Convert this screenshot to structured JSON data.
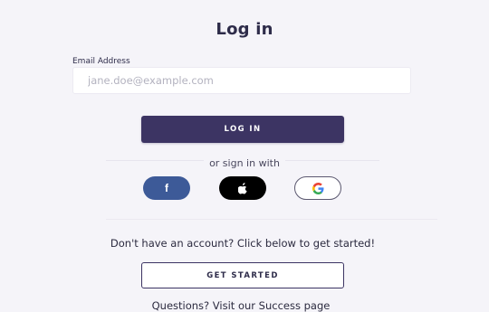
{
  "page": {
    "title": "Log in"
  },
  "login_form": {
    "email_label": "Email Address",
    "email_value": "",
    "email_placeholder": "jane.doe@example.com",
    "submit_label": "LOG IN"
  },
  "social_login": {
    "divider_text": "or sign in with",
    "providers": [
      {
        "name": "facebook",
        "icon": "facebook-icon",
        "glyph": "f",
        "color": "#3d5a98"
      },
      {
        "name": "apple",
        "icon": "apple-icon",
        "color": "#000000"
      },
      {
        "name": "google",
        "icon": "google-icon",
        "color": "#ffffff"
      }
    ]
  },
  "signup": {
    "prompt": "Don't have an account? Click below to get started!",
    "button_label": "GET STARTED"
  },
  "footer": {
    "help_text": "Questions? Visit our Success page"
  },
  "colors": {
    "background": "#f5f4f9",
    "primary": "#3c3463",
    "text": "#2b2a3f",
    "facebook": "#3d5a98",
    "apple": "#000000"
  }
}
